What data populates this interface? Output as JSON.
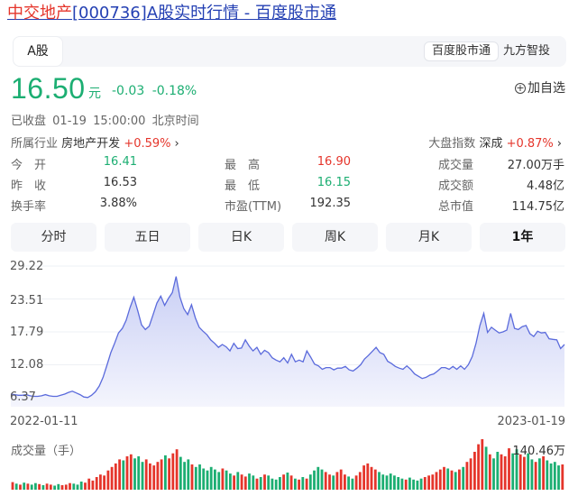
{
  "page": {
    "title_name": "中交地产",
    "title_code": "[000736]",
    "title_rest": "A股实时行情 - 百度股市通"
  },
  "tabs": {
    "a_share": "A股",
    "baidu": "百度股市通",
    "jiufang": "九方智投"
  },
  "quote": {
    "price": "16.50",
    "unit": "元",
    "change": "-0.03",
    "change_pct": "-0.18%",
    "add_watch": "加自选",
    "status": "已收盘",
    "datetime": "01-19 15:00:00",
    "timezone": "北京时间",
    "industry_label": "所属行业",
    "industry_name": "房地产开发",
    "industry_chg": "+0.59%",
    "index_label": "大盘指数",
    "index_name": "深成",
    "index_chg": "+0.87%"
  },
  "stats": {
    "open_label": "今　开",
    "open": "16.41",
    "high_label": "最　高",
    "high": "16.90",
    "volume_label": "成交量",
    "volume": "27.00万手",
    "prev_label": "昨　收",
    "prev": "16.53",
    "low_label": "最　低",
    "low": "16.15",
    "amount_label": "成交额",
    "amount": "4.48亿",
    "turnover_label": "换手率",
    "turnover": "3.88%",
    "pe_label": "市盈(TTM)",
    "pe": "192.35",
    "mcap_label": "总市值",
    "mcap": "114.75亿"
  },
  "periods": [
    "分时",
    "五日",
    "日K",
    "周K",
    "月K",
    "1年"
  ],
  "active_period": "1年",
  "colors": {
    "up": "#e5352b",
    "down": "#1cae72",
    "line": "#5b6bdc",
    "area_top": "#c9cff5",
    "area_bottom": "#f4f5fd",
    "link": "#2440b3"
  },
  "chart_data": {
    "type": "area",
    "y_ticks": [
      "29.22",
      "23.51",
      "17.79",
      "12.08",
      "6.37"
    ],
    "ylim": [
      6.37,
      29.22
    ],
    "x_start": "2022-01-11",
    "x_end": "2023-01-19",
    "values": [
      7.0,
      6.9,
      6.8,
      6.8,
      6.9,
      6.7,
      6.6,
      6.6,
      6.7,
      6.9,
      6.7,
      6.6,
      6.6,
      6.8,
      7.0,
      7.3,
      7.5,
      7.2,
      6.9,
      6.5,
      6.4,
      6.8,
      7.4,
      8.4,
      9.9,
      12.0,
      14.2,
      15.8,
      17.6,
      18.4,
      19.8,
      22.0,
      23.8,
      21.5,
      19.0,
      18.2,
      18.8,
      20.8,
      22.8,
      24.0,
      22.4,
      23.6,
      24.6,
      27.4,
      23.8,
      21.8,
      20.8,
      22.5,
      20.2,
      18.6,
      17.9,
      17.3,
      16.4,
      15.8,
      15.1,
      15.6,
      15.2,
      14.5,
      15.8,
      14.9,
      15.0,
      16.4,
      15.3,
      14.5,
      15.1,
      13.9,
      14.6,
      14.2,
      13.3,
      12.9,
      12.6,
      13.3,
      12.4,
      13.9,
      12.6,
      12.9,
      12.6,
      14.5,
      13.4,
      12.2,
      11.9,
      11.3,
      11.6,
      11.6,
      11.2,
      11.5,
      11.5,
      11.8,
      11.2,
      11.0,
      11.5,
      12.1,
      13.1,
      13.7,
      14.4,
      15.1,
      14.2,
      13.9,
      12.7,
      12.3,
      11.8,
      11.5,
      11.3,
      11.9,
      11.3,
      10.5,
      10.1,
      9.7,
      9.9,
      10.3,
      10.5,
      11.0,
      11.6,
      11.6,
      11.3,
      11.8,
      11.3,
      11.9,
      11.3,
      12.1,
      13.5,
      15.8,
      18.9,
      21.0,
      17.7,
      18.6,
      18.1,
      17.6,
      17.8,
      18.1,
      21.0,
      18.4,
      18.2,
      18.7,
      18.9,
      17.5,
      17.0,
      17.9,
      17.6,
      17.7,
      16.6,
      16.5,
      16.4,
      14.9,
      15.6
    ]
  },
  "volume": {
    "label": "成交量（手）",
    "max_label": "140.46万",
    "values": [
      0.15,
      0.12,
      0.1,
      0.14,
      0.12,
      0.1,
      0.13,
      0.11,
      0.09,
      0.12,
      0.1,
      0.08,
      0.11,
      0.09,
      0.1,
      0.13,
      0.12,
      0.1,
      0.16,
      0.14,
      0.22,
      0.18,
      0.25,
      0.3,
      0.28,
      0.38,
      0.45,
      0.52,
      0.6,
      0.58,
      0.66,
      0.7,
      0.62,
      0.66,
      0.55,
      0.6,
      0.52,
      0.48,
      0.55,
      0.6,
      0.68,
      0.62,
      0.72,
      0.8,
      0.65,
      0.55,
      0.6,
      0.5,
      0.45,
      0.5,
      0.42,
      0.38,
      0.45,
      0.4,
      0.35,
      0.42,
      0.38,
      0.32,
      0.28,
      0.35,
      0.3,
      0.26,
      0.32,
      0.28,
      0.22,
      0.25,
      0.3,
      0.28,
      0.22,
      0.2,
      0.25,
      0.3,
      0.34,
      0.28,
      0.22,
      0.2,
      0.25,
      0.22,
      0.3,
      0.38,
      0.45,
      0.4,
      0.35,
      0.3,
      0.28,
      0.35,
      0.4,
      0.3,
      0.26,
      0.22,
      0.28,
      0.35,
      0.48,
      0.52,
      0.45,
      0.4,
      0.35,
      0.3,
      0.28,
      0.32,
      0.28,
      0.25,
      0.22,
      0.2,
      0.24,
      0.2,
      0.18,
      0.22,
      0.25,
      0.28,
      0.3,
      0.35,
      0.4,
      0.45,
      0.42,
      0.38,
      0.35,
      0.4,
      0.45,
      0.55,
      0.62,
      0.75,
      0.9,
      1.0,
      0.85,
      0.7,
      0.62,
      0.75,
      0.7,
      0.66,
      0.82,
      0.72,
      0.8,
      0.7,
      0.65,
      0.72,
      0.6,
      0.55,
      0.62,
      0.66,
      0.58,
      0.52,
      0.55,
      0.48,
      0.5
    ],
    "up_flags": [
      1,
      0,
      1,
      0,
      1,
      0,
      0,
      1,
      0,
      1,
      1,
      0,
      0,
      1,
      1,
      1,
      0,
      0,
      0,
      1,
      1,
      1,
      1,
      1,
      1,
      1,
      1,
      1,
      1,
      0,
      1,
      1,
      0,
      0,
      0,
      1,
      1,
      1,
      1,
      1,
      0,
      1,
      1,
      1,
      0,
      0,
      0,
      1,
      0,
      0,
      0,
      0,
      0,
      0,
      0,
      1,
      0,
      0,
      1,
      0,
      1,
      1,
      0,
      0,
      1,
      0,
      1,
      0,
      0,
      0,
      0,
      1,
      0,
      1,
      0,
      1,
      0,
      1,
      0,
      0,
      0,
      0,
      1,
      1,
      0,
      1,
      1,
      1,
      0,
      0,
      1,
      1,
      1,
      1,
      1,
      1,
      0,
      0,
      0,
      0,
      0,
      0,
      0,
      1,
      0,
      0,
      0,
      0,
      1,
      1,
      1,
      1,
      1,
      1,
      0,
      1,
      0,
      1,
      0,
      1,
      1,
      1,
      1,
      1,
      0,
      1,
      0,
      0,
      1,
      1,
      1,
      0,
      0,
      1,
      1,
      0,
      0,
      1,
      0,
      1,
      0,
      0,
      0,
      0,
      1
    ]
  }
}
